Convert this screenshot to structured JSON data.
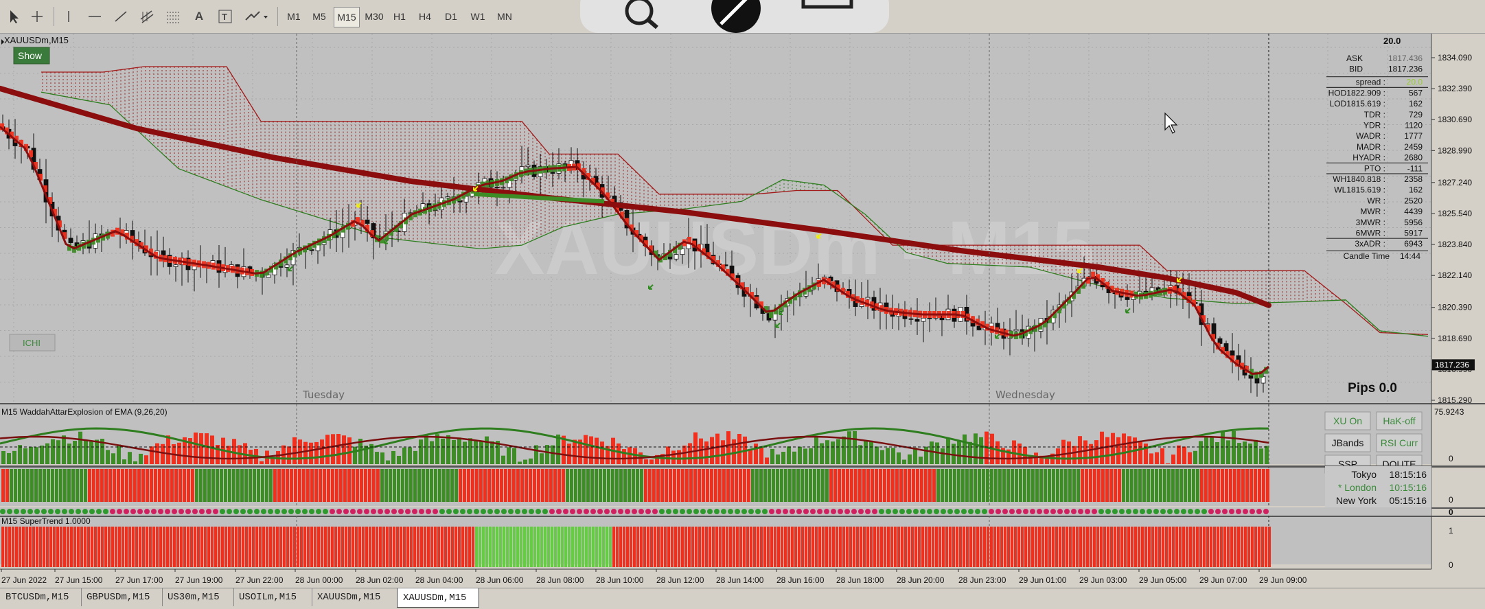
{
  "toolbar": {
    "tools": [
      "cursor-icon",
      "crosshair-icon",
      "vertical-line-icon",
      "horizontal-line-icon",
      "trendline-icon",
      "channel-icon",
      "fibonacci-icon",
      "text-icon",
      "text-label-icon",
      "arrow-icon"
    ],
    "text_tool_label": "A",
    "timeframes": [
      "M1",
      "M5",
      "M15",
      "M30",
      "H1",
      "H4",
      "D1",
      "W1",
      "MN"
    ],
    "active_timeframe": "M15"
  },
  "chart": {
    "symbol_label": "XAUUSDm,M15",
    "watermark": "XAUUSDm - M15",
    "show_button": "Show",
    "ichi_button": "ICHI",
    "day_labels": [
      {
        "text": "Tuesday"
      },
      {
        "text": "Wednesday"
      }
    ],
    "pips": "Pips 0.0",
    "current_price": "1817.236",
    "price_ticks": [
      "1834.090",
      "1832.390",
      "1830.690",
      "1828.990",
      "1827.240",
      "1825.540",
      "1823.840",
      "1822.140",
      "1820.390",
      "1818.690",
      "1816.990",
      "1815.290"
    ],
    "time_ticks": [
      "27 Jun 2022",
      "27 Jun 15:00",
      "27 Jun 17:00",
      "27 Jun 19:00",
      "27 Jun 22:00",
      "28 Jun 00:00",
      "28 Jun 02:00",
      "28 Jun 04:00",
      "28 Jun 06:00",
      "28 Jun 08:00",
      "28 Jun 10:00",
      "28 Jun 12:00",
      "28 Jun 14:00",
      "28 Jun 16:00",
      "28 Jun 18:00",
      "28 Jun 20:00",
      "28 Jun 23:00",
      "29 Jun 01:00",
      "29 Jun 03:00",
      "29 Jun 05:00",
      "29 Jun 07:00",
      "29 Jun 09:00"
    ],
    "info_panel": {
      "top": "20.0",
      "rows": [
        [
          "ASK",
          "1817.436"
        ],
        [
          "BID",
          "1817.236"
        ],
        [
          "spread :",
          "20.0"
        ],
        [
          "HOD1822.909 :",
          "567"
        ],
        [
          "LOD1815.619 :",
          "162"
        ],
        [
          "TDR :",
          "729"
        ],
        [
          "YDR :",
          "1120"
        ],
        [
          "WADR :",
          "1777"
        ],
        [
          "MADR :",
          "2459"
        ],
        [
          "HYADR :",
          "2680"
        ],
        [
          "PTO :",
          "-111"
        ],
        [
          "WH1840.818 :",
          "2358"
        ],
        [
          "WL1815.619 :",
          "162"
        ],
        [
          "WR :",
          "2520"
        ],
        [
          "MWR :",
          "4439"
        ],
        [
          "3MWR :",
          "5956"
        ],
        [
          "6MWR :",
          "5917"
        ],
        [
          "3xADR :",
          "6943"
        ],
        [
          "Candle Time",
          "14:44"
        ]
      ]
    }
  },
  "indicators": {
    "wae_label": "M15 WaddahAttarExplosion of EMA (9,26,20)",
    "wae_scale_top": "75.9243",
    "wae_scale_zero": "0",
    "buttons": [
      "XU On",
      "HaK-off",
      "JBands",
      "RSI Curr",
      "SSP",
      "DOUTE"
    ],
    "sessions": [
      [
        "Tokyo",
        "18:15:16"
      ],
      [
        "* London",
        "10:15:16"
      ],
      [
        "New York",
        "05:15:16"
      ]
    ],
    "zero_a": "0",
    "zero_b": "0",
    "supertrend_label": "M15 SuperTrend 1.0000",
    "st_scale_top": "1",
    "st_scale_bottom": "0"
  },
  "tabs": [
    "BTCUSDm,M15",
    "GBPUSDm,M15",
    "US30m,M15",
    "USOILm,M15",
    "XAUUSDm,M15",
    "XAUUSDm,M15"
  ],
  "active_tab": 5,
  "colors": {
    "bull": "#3d8c26",
    "bear": "#f0301e",
    "ema": "#8b0d0d",
    "cloud_green": "#2e7d1e",
    "cloud_red": "#a31a1a",
    "bg": "#c0c0c0",
    "st_green": "#66cc44"
  }
}
